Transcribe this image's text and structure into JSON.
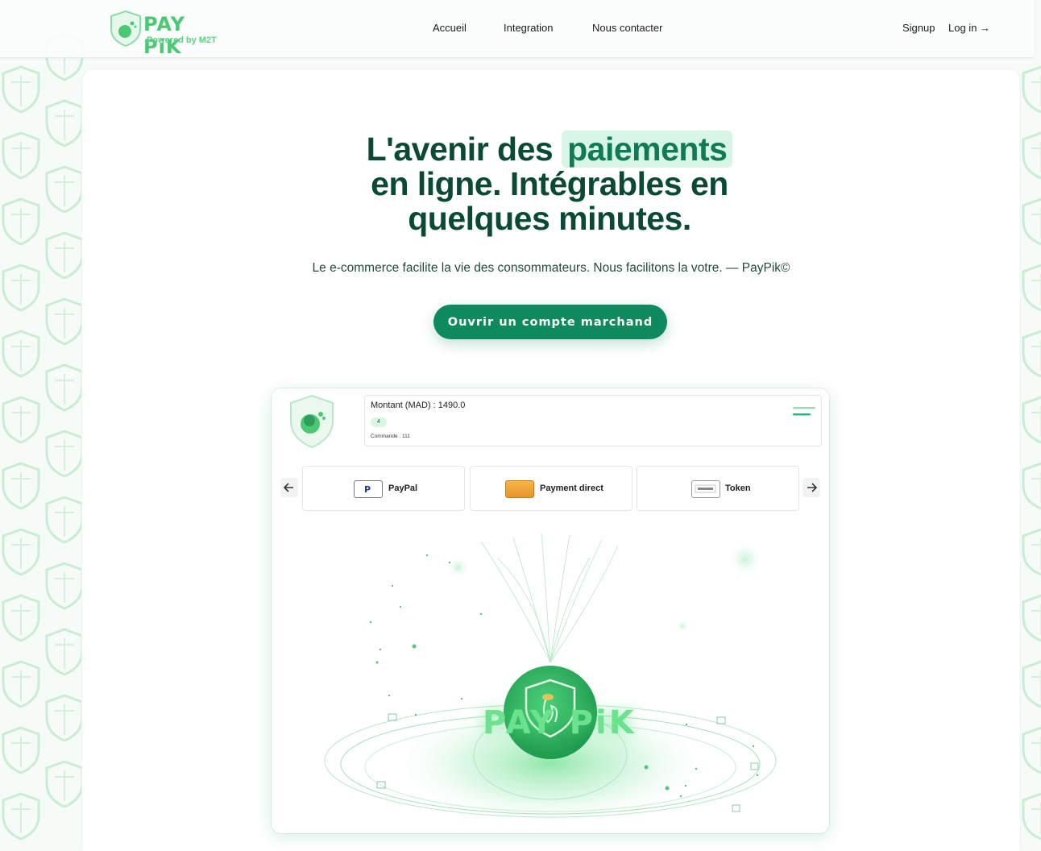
{
  "header": {
    "logo_text": "PAY PiK",
    "logo_subtitle": "Powered by M2T",
    "nav": [
      {
        "label": "Accueil"
      },
      {
        "label": "Integration"
      },
      {
        "label": "Nous contacter"
      }
    ],
    "signup": "Signup",
    "login": "Log in →"
  },
  "hero": {
    "title_before": "L'avenir des",
    "title_highlight": "paiements",
    "title_after": "en ligne. Intégrables en quelques minutes.",
    "subtitle": "Le e-commerce facilite la vie des consommateurs. Nous facilitons la votre. — PayPik©",
    "cta": "Ouvrir un compte marchand"
  },
  "demo": {
    "amount": "Montant (MAD) : 1490.0",
    "badge": "4",
    "order": "Commande : 111",
    "methods": [
      {
        "label": "PayPal",
        "icon": "paypal-icon"
      },
      {
        "label": "Payment direct",
        "icon": "payment-direct-icon"
      },
      {
        "label": "Token",
        "icon": "token-icon"
      }
    ],
    "wordmark": "PAY PiK"
  },
  "colors": {
    "brand_green": "#0f8a5f",
    "logo_green": "#4cc873",
    "title_dark_green": "#0a4a35",
    "highlight_bg": "#d8f6e6"
  }
}
